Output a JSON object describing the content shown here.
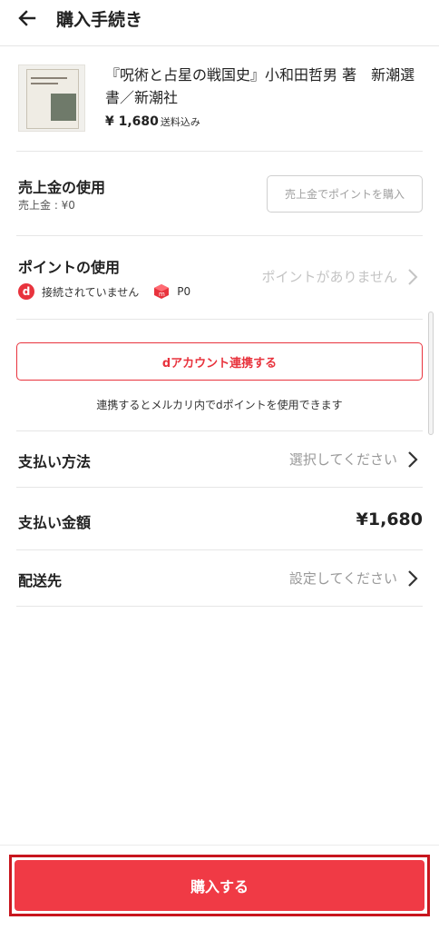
{
  "header": {
    "title": "購入手続き",
    "back_icon": "arrow-left-icon"
  },
  "product": {
    "title": "『呪術と占星の戦国史』小和田哲男 著　新潮選書／新潮社",
    "price": "¥ 1,680",
    "shipping_note": "送料込み"
  },
  "sales": {
    "title": "売上金の使用",
    "balance": "売上金 : ¥0",
    "button_label": "売上金でポイントを購入"
  },
  "points": {
    "title": "ポイントの使用",
    "d_logo": "d",
    "d_status": "接続されていません",
    "merpoint": "P0",
    "none_label": "ポイントがありません"
  },
  "d_account": {
    "button_label": "dアカウント連携する",
    "note": "連携するとメルカリ内でdポイントを使用できます"
  },
  "payment_method": {
    "title": "支払い方法",
    "value": "選択してください"
  },
  "payment_amount": {
    "title": "支払い金額",
    "value": "¥1,680"
  },
  "shipping": {
    "title": "配送先",
    "value": "設定してください"
  },
  "footer": {
    "buy_label": "購入する"
  },
  "colors": {
    "accent": "#e8333d",
    "buy_button": "#f03a45",
    "buy_outline": "#c8161e"
  }
}
